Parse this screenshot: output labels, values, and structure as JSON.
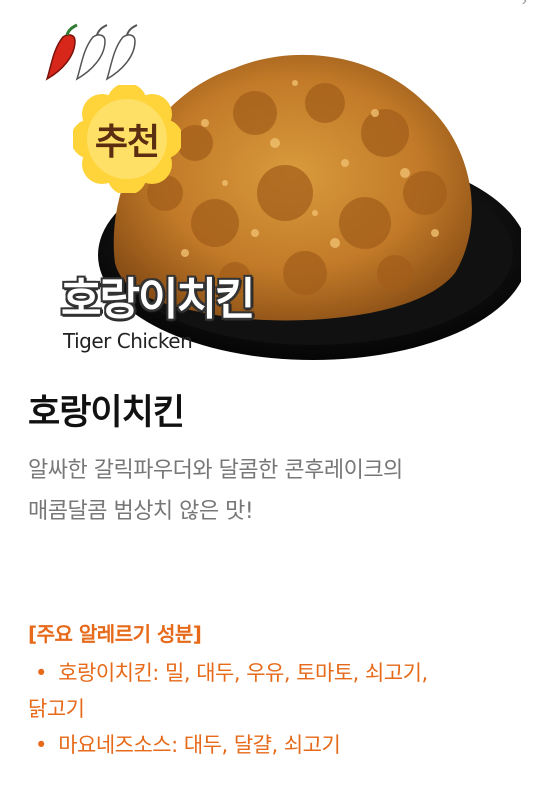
{
  "hero": {
    "badge_text": "추천",
    "title_overlay": "호랑이치킨",
    "subtitle_overlay": "Tiger Chicken",
    "spice_level": 1,
    "spice_max": 3,
    "corner_icon": "chevron-right-icon"
  },
  "menu": {
    "title": "호랑이치킨",
    "description_line1": "알싸한 갈릭파우더와 달콤한 콘후레이크의",
    "description_line2": "매콤달콤 범상치 않은 맛!"
  },
  "allergy": {
    "heading": "[주요 알레르기 성분]",
    "items": [
      {
        "bullet": "•",
        "text": "호랑이치킨: 밀, 대두, 우유, 토마토, 쇠고기,",
        "text_cont": "닭고기"
      },
      {
        "bullet": "•",
        "text": "마요네즈소스: 대두, 달걀, 쇠고기"
      }
    ]
  },
  "colors": {
    "accent": "#e66a1a",
    "title": "#111111",
    "description": "#777777",
    "badge": "#ffd43b"
  }
}
